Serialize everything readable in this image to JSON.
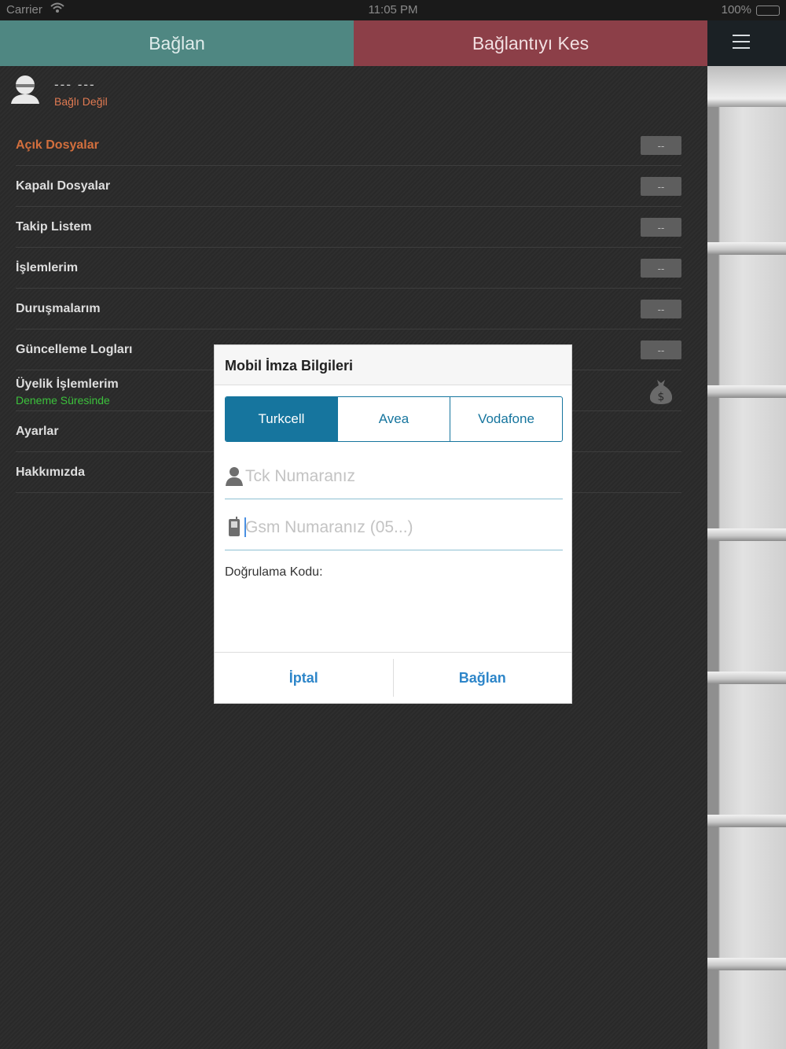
{
  "status_bar": {
    "carrier": "Carrier",
    "time": "11:05 PM",
    "battery": "100%"
  },
  "top_bar": {
    "connect_label": "Bağlan",
    "disconnect_label": "Bağlantıyı Kes",
    "connect_color": "#4f8782",
    "disconnect_color": "#8c3f48"
  },
  "profile": {
    "name": "--- ---",
    "status": "Bağlı Değil"
  },
  "menu": {
    "items": [
      {
        "label": "Açık Dosyalar",
        "badge": "--"
      },
      {
        "label": "Kapalı Dosyalar",
        "badge": "--"
      },
      {
        "label": "Takip Listem",
        "badge": "--"
      },
      {
        "label": "İşlemlerim",
        "badge": "--"
      },
      {
        "label": "Duruşmalarım",
        "badge": "--"
      },
      {
        "label": "Güncelleme Logları",
        "badge": "--"
      },
      {
        "label": "Üyelik İşlemlerim",
        "sub": "Deneme Süresinde",
        "icon": "money-bag-icon"
      },
      {
        "label": "Ayarlar"
      },
      {
        "label": "Hakkımızda"
      }
    ]
  },
  "dialog": {
    "title": "Mobil İmza Bilgileri",
    "operators": [
      "Turkcell",
      "Avea",
      "Vodafone"
    ],
    "selected_operator": "Turkcell",
    "tck_placeholder": "Tck Numaranız",
    "gsm_placeholder": "Gsm Numaranız (05...)",
    "verification_label": "Doğrulama Kodu:",
    "cancel_label": "İptal",
    "connect_label": "Bağlan",
    "accent_color": "#16759e"
  }
}
